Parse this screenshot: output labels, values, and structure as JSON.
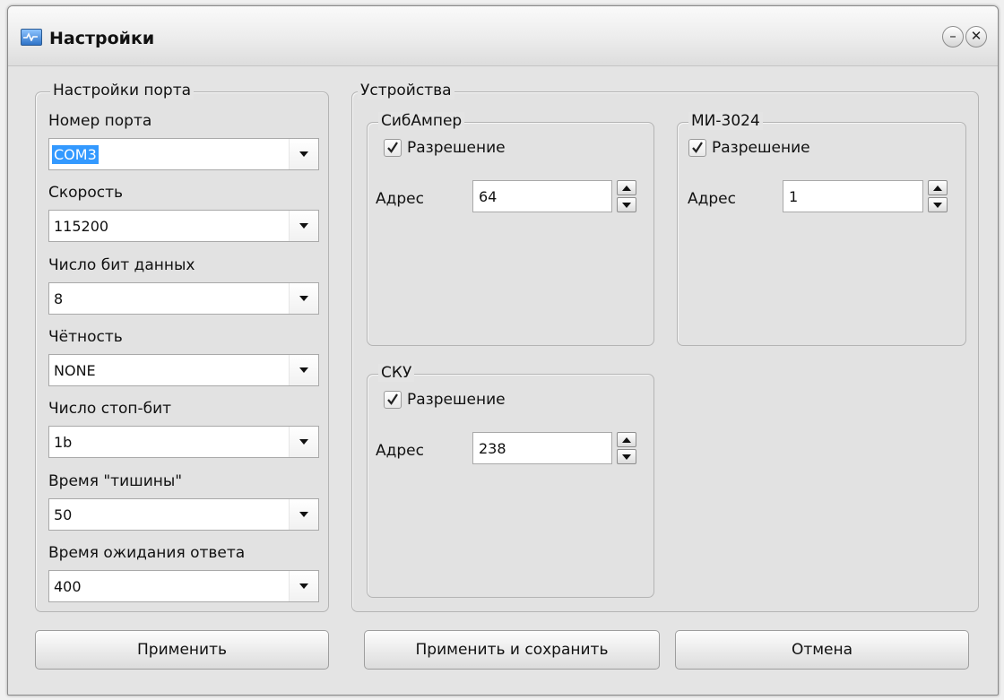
{
  "window": {
    "title": "Настройки",
    "minimize_glyph": "–",
    "close_glyph": "✕"
  },
  "port_settings": {
    "title": "Настройки порта",
    "fields": [
      {
        "label": "Номер порта",
        "value": "COM3"
      },
      {
        "label": "Скорость",
        "value": "115200"
      },
      {
        "label": "Число бит данных",
        "value": "8"
      },
      {
        "label": "Чётность",
        "value": "NONE"
      },
      {
        "label": "Число стоп-бит",
        "value": "1b"
      },
      {
        "label": "Время \"тишины\"",
        "value": "50"
      },
      {
        "label": "Время ожидания ответа",
        "value": "400"
      }
    ]
  },
  "devices": {
    "title": "Устройства",
    "groups": [
      {
        "title": "СибАмпер",
        "enable_label": "Разрешение",
        "enabled": true,
        "address_label": "Адрес",
        "address": "64"
      },
      {
        "title": "МИ-3024",
        "enable_label": "Разрешение",
        "enabled": true,
        "address_label": "Адрес",
        "address": "1"
      },
      {
        "title": "СКУ",
        "enable_label": "Разрешение",
        "enabled": true,
        "address_label": "Адрес",
        "address": "238"
      }
    ]
  },
  "buttons": {
    "apply": "Применить",
    "apply_save": "Применить и сохранить",
    "cancel": "Отмена"
  },
  "colors": {
    "selection": "#3399ff",
    "app_icon": "#2f74c8"
  },
  "icons": {
    "app": "settings-app-icon",
    "minimize": "minimize-icon",
    "close": "close-icon",
    "check": "checkmark-icon",
    "combo_arrow": "chevron-down-icon"
  }
}
